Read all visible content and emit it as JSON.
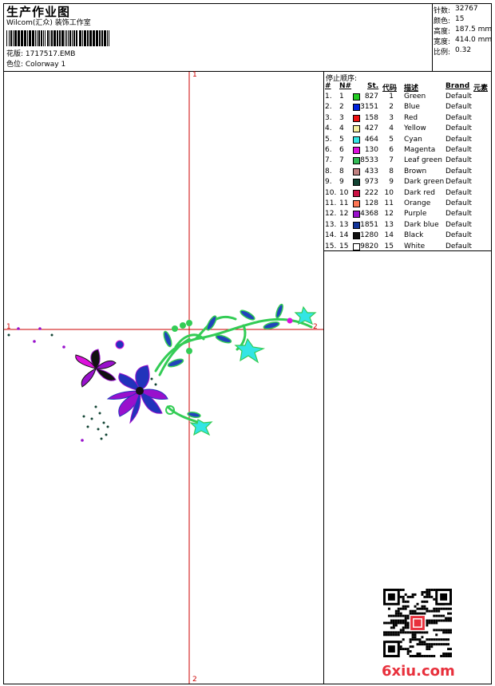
{
  "header": {
    "title": "生产作业图",
    "company": "Wilcom(汇众) 装饰工作室",
    "design_label": "花版: 1717517.EMB",
    "colorway_label": "色位:  Colorway 1"
  },
  "stats": [
    {
      "label": "针数:",
      "value": "32767"
    },
    {
      "label": "颜色:",
      "value": "15"
    },
    {
      "label": "高度:",
      "value": "187.5 mm"
    },
    {
      "label": "宽度:",
      "value": "414.0 mm"
    },
    {
      "label": "比例:",
      "value": "0.32"
    }
  ],
  "stop_sequence": {
    "title": "停止顺序:",
    "headers": [
      "#",
      "N#",
      "St.",
      "代码",
      "描述",
      "Brand",
      "元素"
    ],
    "rows": [
      {
        "idx": "1.",
        "n": "1",
        "color": "#22cc22",
        "stitches": "827",
        "code": "1",
        "desc": "Green",
        "brand": "Default"
      },
      {
        "idx": "2.",
        "n": "2",
        "color": "#0022dd",
        "stitches": "3151",
        "code": "2",
        "desc": "Blue",
        "brand": "Default"
      },
      {
        "idx": "3.",
        "n": "3",
        "color": "#ee1111",
        "stitches": "158",
        "code": "3",
        "desc": "Red",
        "brand": "Default"
      },
      {
        "idx": "4.",
        "n": "4",
        "color": "#f5f0a0",
        "stitches": "427",
        "code": "4",
        "desc": "Yellow",
        "brand": "Default"
      },
      {
        "idx": "5.",
        "n": "5",
        "color": "#33e5e5",
        "stitches": "464",
        "code": "5",
        "desc": "Cyan",
        "brand": "Default"
      },
      {
        "idx": "6.",
        "n": "6",
        "color": "#dd11dd",
        "stitches": "130",
        "code": "6",
        "desc": "Magenta",
        "brand": "Default"
      },
      {
        "idx": "7.",
        "n": "7",
        "color": "#33bb55",
        "stitches": "8533",
        "code": "7",
        "desc": "Leaf green",
        "brand": "Default"
      },
      {
        "idx": "8.",
        "n": "8",
        "color": "#c08080",
        "stitches": "433",
        "code": "8",
        "desc": "Brown",
        "brand": "Default"
      },
      {
        "idx": "9.",
        "n": "9",
        "color": "#114433",
        "stitches": "973",
        "code": "9",
        "desc": "Dark green",
        "brand": "Default"
      },
      {
        "idx": "10.",
        "n": "10",
        "color": "#cc1144",
        "stitches": "222",
        "code": "10",
        "desc": "Dark red",
        "brand": "Default"
      },
      {
        "idx": "11.",
        "n": "11",
        "color": "#ff7755",
        "stitches": "128",
        "code": "11",
        "desc": "Orange",
        "brand": "Default"
      },
      {
        "idx": "12.",
        "n": "12",
        "color": "#9911cc",
        "stitches": "4368",
        "code": "12",
        "desc": "Purple",
        "brand": "Default"
      },
      {
        "idx": "13.",
        "n": "13",
        "color": "#113399",
        "stitches": "1851",
        "code": "13",
        "desc": "Dark blue",
        "brand": "Default"
      },
      {
        "idx": "14.",
        "n": "14",
        "color": "#111111",
        "stitches": "1280",
        "code": "14",
        "desc": "Black",
        "brand": "Default"
      },
      {
        "idx": "15.",
        "n": "15",
        "color": "#ffffff",
        "stitches": "9820",
        "code": "15",
        "desc": "White",
        "brand": "Default"
      }
    ]
  },
  "canvas": {
    "marks": {
      "top": "1",
      "bottom": "2",
      "left": "1",
      "right": "2"
    },
    "crosshair_color": "#cc0000"
  },
  "watermark": "6xiu.com",
  "qr_icon": "qr-code-icon"
}
